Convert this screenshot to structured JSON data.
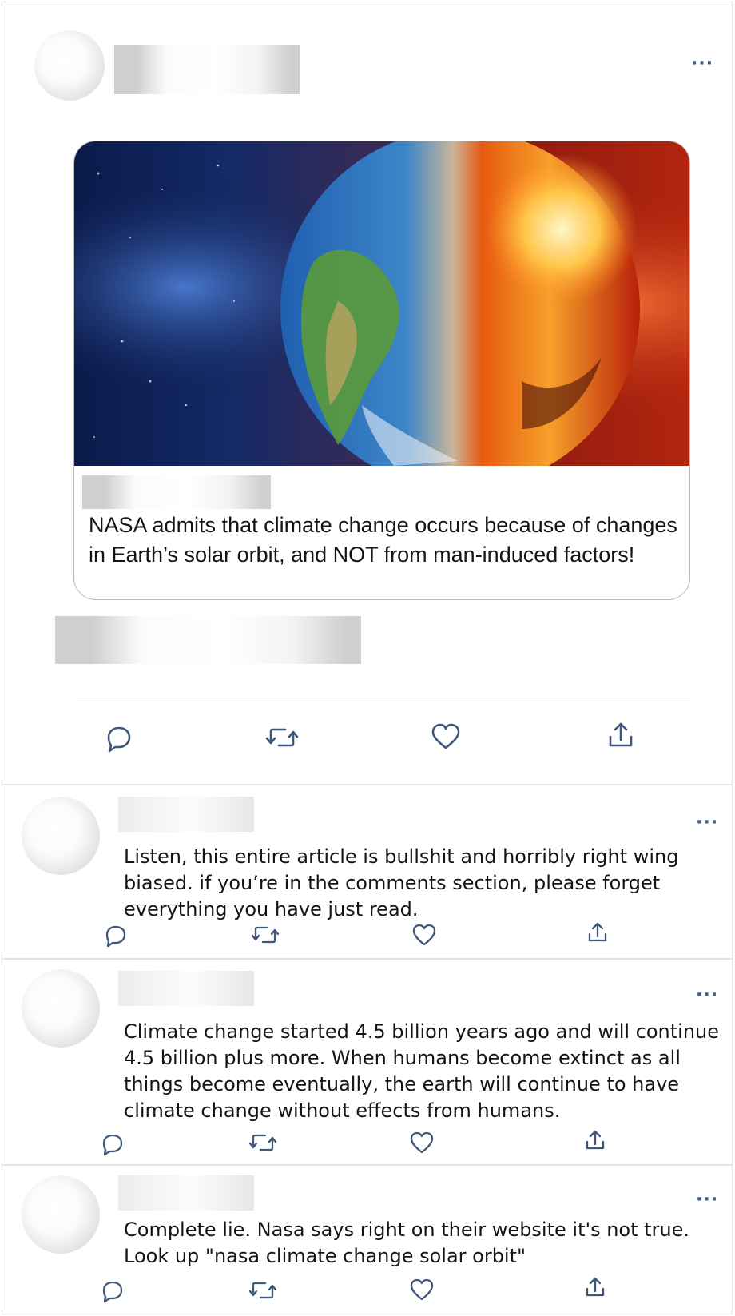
{
  "post": {
    "more_label": "···",
    "card_headline": "NASA admits that climate change occurs because of changes in Earth’s solar orbit, and NOT from man-induced factors!",
    "card_image": "earth-half-blue-half-fire-image",
    "icons": [
      "reply-icon",
      "retweet-icon",
      "like-icon",
      "share-icon"
    ],
    "icon_color": "#3f5778"
  },
  "replies": [
    {
      "more_label": "···",
      "text": "Listen, this entire article is bullshit and horribly right wing biased. if you’re in the comments section, please forget everything you have just read."
    },
    {
      "more_label": "···",
      "text": "Climate change started 4.5 billion years ago and will continue 4.5 billion plus more. When humans become extinct as all things become eventually, the earth will continue to have climate change without effects from humans."
    },
    {
      "more_label": "···",
      "text": "Complete lie. Nasa says right on their website it's not true. Look up \"nasa climate change solar orbit\""
    }
  ]
}
